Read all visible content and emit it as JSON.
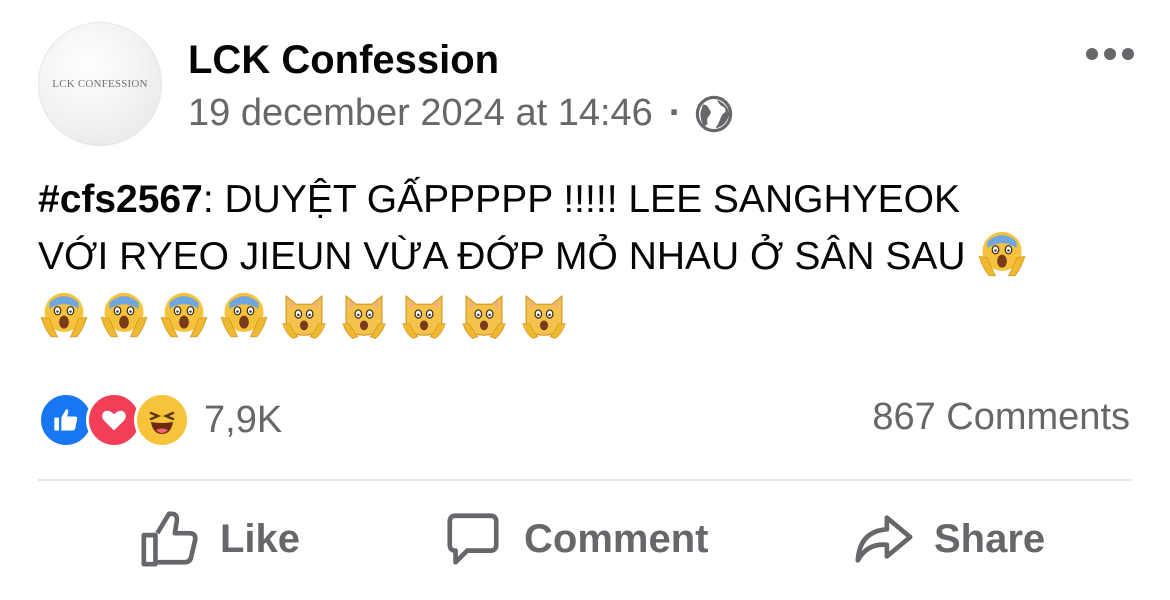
{
  "post": {
    "page_name": "LCK Confession",
    "avatar_text": "LCK CONFESSION",
    "timestamp": "19 december 2024 at 14:46",
    "separator": "·",
    "privacy_icon": "globe-icon",
    "more_icon": "more-options-icon",
    "hashtag": "#cfs2567",
    "text_line1_rest": ": DUYỆT GẤPPPPP !!!!! LEE SANGHYEOK",
    "text_line2": "VỚI RYEO JIEUN VỪA ĐỚP MỎ NHAU Ở SÂN SAU",
    "emojis": [
      "face-screaming-in-fear",
      "face-screaming-in-fear",
      "face-screaming-in-fear",
      "face-screaming-in-fear",
      "face-screaming-in-fear",
      "weary-cat",
      "weary-cat",
      "weary-cat",
      "weary-cat",
      "weary-cat"
    ]
  },
  "stats": {
    "reaction_icons": [
      "like-reaction-icon",
      "love-reaction-icon",
      "haha-reaction-icon"
    ],
    "reaction_count": "7,9K",
    "comments": "867 Comments"
  },
  "actions": {
    "like": "Like",
    "comment": "Comment",
    "share": "Share"
  },
  "colors": {
    "text_primary": "#050505",
    "text_secondary": "#65676b",
    "like_blue": "#1877f2",
    "love_red": "#f33e58",
    "haha_yellow": "#f7c33b"
  }
}
